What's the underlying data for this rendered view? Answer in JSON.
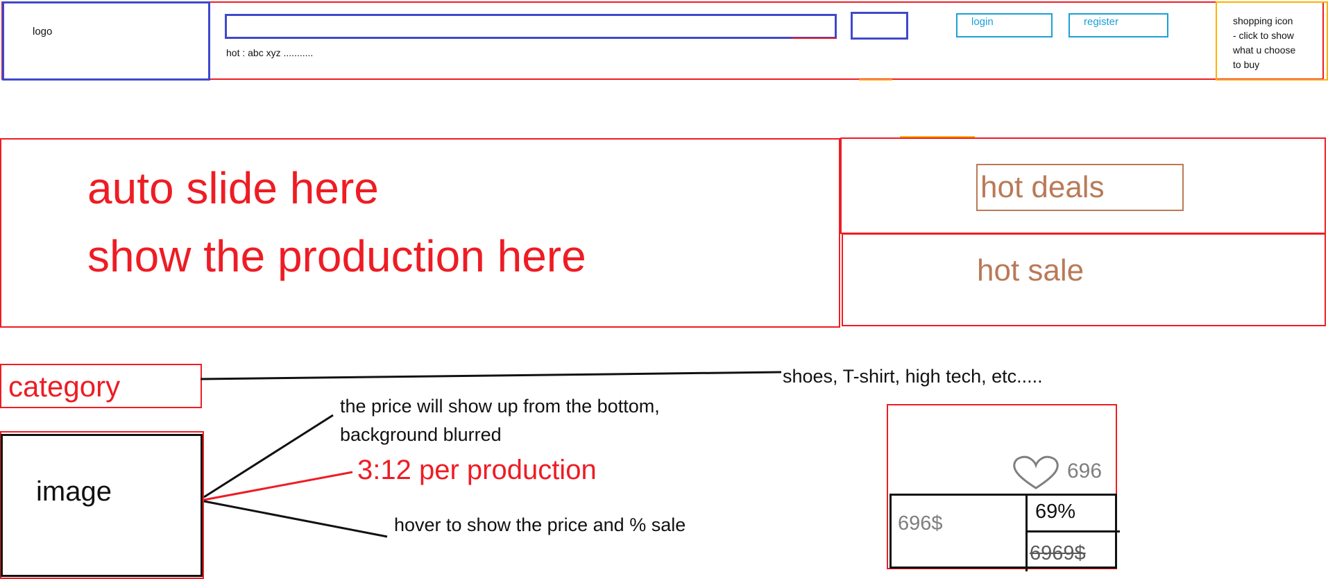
{
  "header": {
    "logo_label": "logo",
    "hot_text": "hot : abc xyz ...........",
    "login_label": "login",
    "register_label": "register",
    "cart_note": "shopping icon\n- click to show\nwhat u choose\nto buy"
  },
  "slider": {
    "line1": "auto slide here",
    "line2": "show the production here"
  },
  "side_panels": {
    "hot_deals_label": "hot deals",
    "hot_sale_label": "hot sale"
  },
  "category": {
    "label": "category",
    "note": "shoes, T-shirt, high tech, etc....."
  },
  "product_image": {
    "label": "image",
    "note_price": "the price will show up from the bottom,\nbackground blurred",
    "note_ratio": "3:12 per production",
    "note_hover": "hover to show the price and % sale"
  },
  "product_card": {
    "likes": "696",
    "price": "696$",
    "discount": "69%",
    "old_price": "6969$"
  },
  "colors": {
    "accent_red": "#ee1c24",
    "brown": "#b97a57",
    "blue_outline": "#3f48cc",
    "light_blue": "#1aa0d8",
    "orange": "#ffb000"
  }
}
